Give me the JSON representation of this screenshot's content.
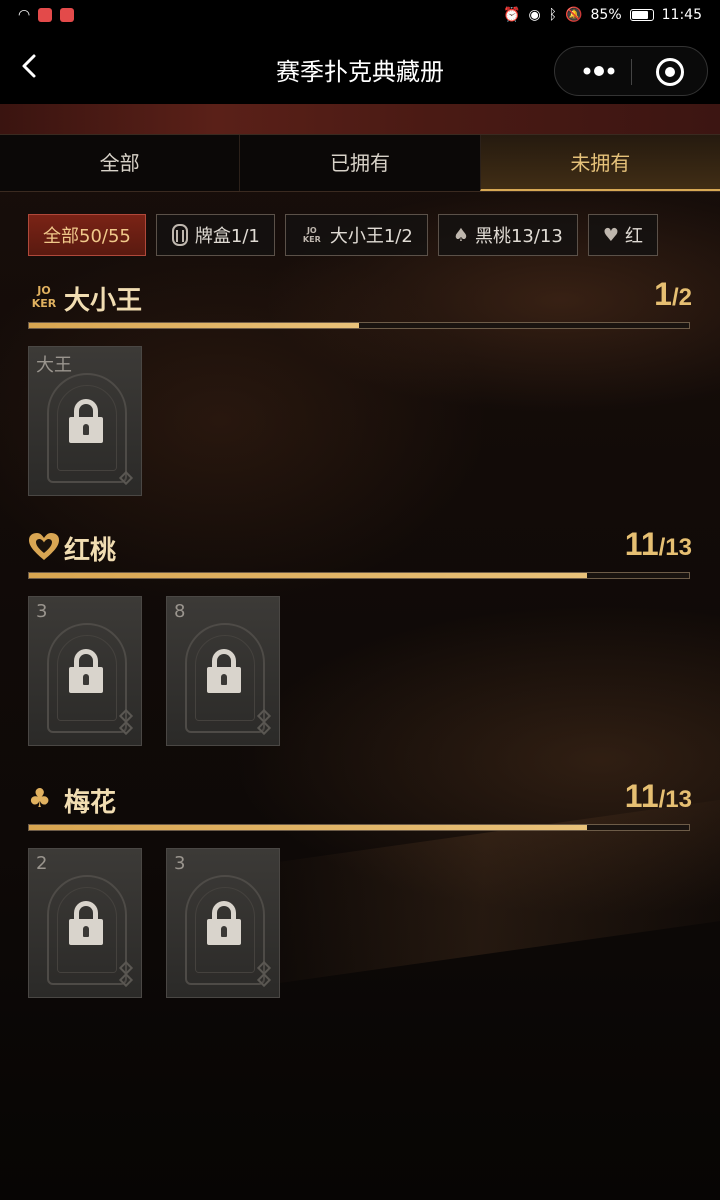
{
  "status_bar": {
    "battery": "85%",
    "time": "11:45"
  },
  "header": {
    "title": "赛季扑克典藏册",
    "back_icon": "chevron-left-icon",
    "more_icon": "more-dots-icon",
    "close_icon": "target-circle-icon"
  },
  "tabs": [
    {
      "label": "全部",
      "active": false
    },
    {
      "label": "已拥有",
      "active": false
    },
    {
      "label": "未拥有",
      "active": true
    }
  ],
  "filters": [
    {
      "label": "全部50/55",
      "icon": "",
      "active": true
    },
    {
      "label": "牌盒1/1",
      "icon": "card-box-icon",
      "active": false
    },
    {
      "label": "大小王1/2",
      "icon": "joker-icon",
      "active": false
    },
    {
      "label": "黑桃13/13",
      "icon": "spade-icon",
      "active": false
    },
    {
      "label": "红",
      "icon": "heart-icon",
      "active": false
    }
  ],
  "joker_icon_text": [
    "JO",
    "KER"
  ],
  "sections": [
    {
      "title": "大小王",
      "icon": "joker-icon",
      "owned": "1",
      "total": "2",
      "progress": 0.5,
      "cards": [
        {
          "rank": "大王",
          "locked": true
        }
      ]
    },
    {
      "title": "红桃",
      "icon": "heart-icon",
      "owned": "11",
      "total": "13",
      "progress": 0.846,
      "cards": [
        {
          "rank": "3",
          "locked": true
        },
        {
          "rank": "8",
          "locked": true
        }
      ]
    },
    {
      "title": "梅花",
      "icon": "club-icon",
      "owned": "11",
      "total": "13",
      "progress": 0.846,
      "cards": [
        {
          "rank": "2",
          "locked": true
        },
        {
          "rank": "3",
          "locked": true
        }
      ]
    }
  ]
}
